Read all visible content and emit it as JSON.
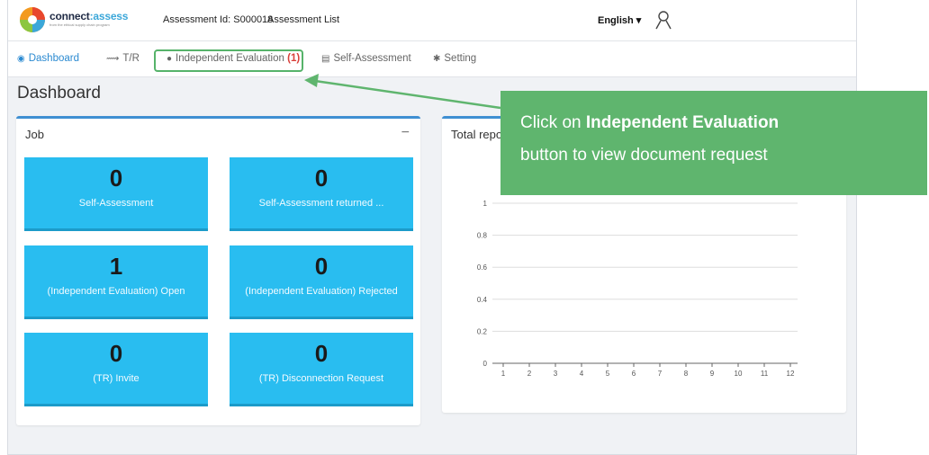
{
  "topbar": {
    "logo_name": "connect",
    "logo_suffix": ":assess",
    "logo_tagline": "from the ethical supply chain program",
    "assessment_id": "Assessment Id: S000018",
    "assessment_list": "Assessment List",
    "language": "English ▾"
  },
  "nav": {
    "dashboard": "Dashboard",
    "tr": "T/R",
    "independent_evaluation": "Independent Evaluation",
    "independent_evaluation_badge": "(1)",
    "self_assessment": "Self-Assessment",
    "setting": "Setting"
  },
  "page": {
    "title": "Dashboard"
  },
  "job_panel": {
    "title": "Job",
    "collapse": "−",
    "tiles": [
      {
        "value": "0",
        "label": "Self-Assessment"
      },
      {
        "value": "0",
        "label": "Self-Assessment returned ..."
      },
      {
        "value": "1",
        "label": "(Independent Evaluation) Open"
      },
      {
        "value": "0",
        "label": "(Independent Evaluation) Rejected"
      },
      {
        "value": "0",
        "label": "(TR) Invite"
      },
      {
        "value": "0",
        "label": "(TR) Disconnection Request"
      }
    ]
  },
  "report_panel": {
    "title": "Total repo"
  },
  "chart_data": {
    "type": "line",
    "x": [
      1,
      2,
      3,
      4,
      5,
      6,
      7,
      8,
      9,
      10,
      11,
      12
    ],
    "ylim": [
      0,
      1
    ],
    "yticks": [
      "0",
      "0.2",
      "0.4",
      "0.6",
      "0.8",
      "1"
    ],
    "series": [],
    "grid": true
  },
  "callout": {
    "prefix": "Click on ",
    "bold": "Independent Evaluation",
    "suffix": "button to view document request"
  },
  "colors": {
    "accent": "#2b8ad1",
    "tile": "#29bdf0",
    "callout": "#5fb56e",
    "badge": "#d9403a"
  }
}
